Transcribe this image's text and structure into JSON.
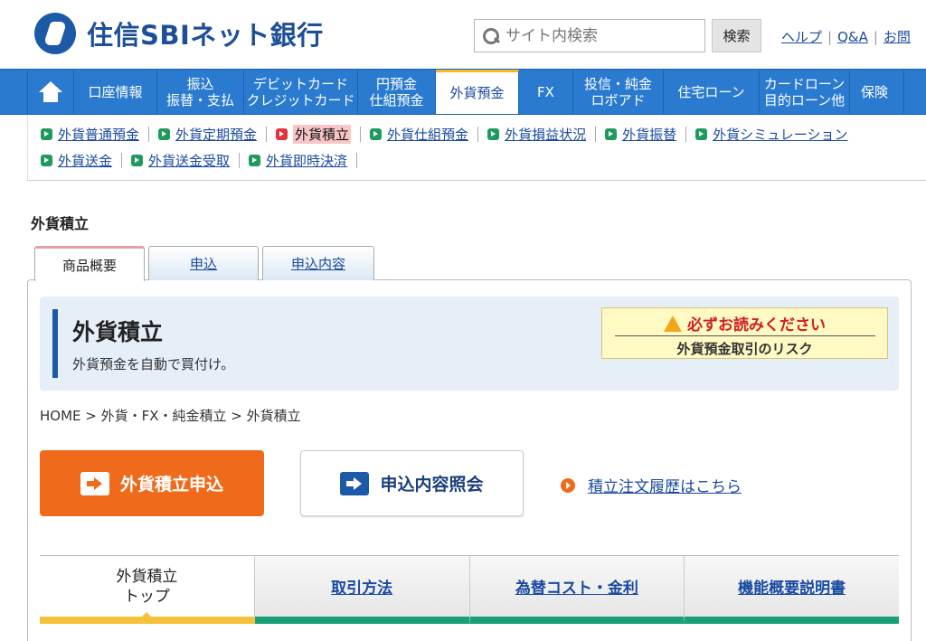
{
  "header": {
    "bank_name": "住信SBIネット銀行",
    "search_placeholder": "サイト内検索",
    "search_button": "検索",
    "links": [
      "ヘルプ",
      "Q&A",
      "お問"
    ]
  },
  "gnav": {
    "items": [
      {
        "line1": "口座情報",
        "line2": ""
      },
      {
        "line1": "振込",
        "line2": "振替・支払"
      },
      {
        "line1": "デビットカード",
        "line2": "クレジットカード"
      },
      {
        "line1": "円預金",
        "line2": "仕組預金"
      },
      {
        "line1": "外貨預金",
        "line2": ""
      },
      {
        "line1": "FX",
        "line2": ""
      },
      {
        "line1": "投信・純金",
        "line2": "ロボアド"
      },
      {
        "line1": "住宅ローン",
        "line2": ""
      },
      {
        "line1": "カードローン",
        "line2": "目的ローン他"
      },
      {
        "line1": "保険",
        "line2": ""
      }
    ]
  },
  "subnav": {
    "row1": [
      "外貨普通預金",
      "外貨定期預金",
      "外貨積立",
      "外貨仕組預金",
      "外貨損益状況",
      "外貨振替",
      "外貨シミュレーション"
    ],
    "row2": [
      "外貨送金",
      "外貨送金受取",
      "外貨即時決済"
    ]
  },
  "page_title": "外貨積立",
  "tabs": [
    "商品概要",
    "申込",
    "申込内容"
  ],
  "hero": {
    "title": "外貨積立",
    "description": "外貨預金を自動で買付け。",
    "risk_line1": "必ずお読みください",
    "risk_line2": "外貨預金取引のリスク"
  },
  "breadcrumb": "HOME > 外貨・FX・純金積立 > 外貨積立",
  "actions": {
    "apply": "外貨積立申込",
    "inquiry": "申込内容照会",
    "history_link": "積立注文履歴はこちら"
  },
  "subtabs": {
    "top_line1": "外貨積立",
    "top_line2": "トップ",
    "items": [
      "取引方法",
      "為替コスト・金利",
      "機能概要説明書"
    ]
  }
}
